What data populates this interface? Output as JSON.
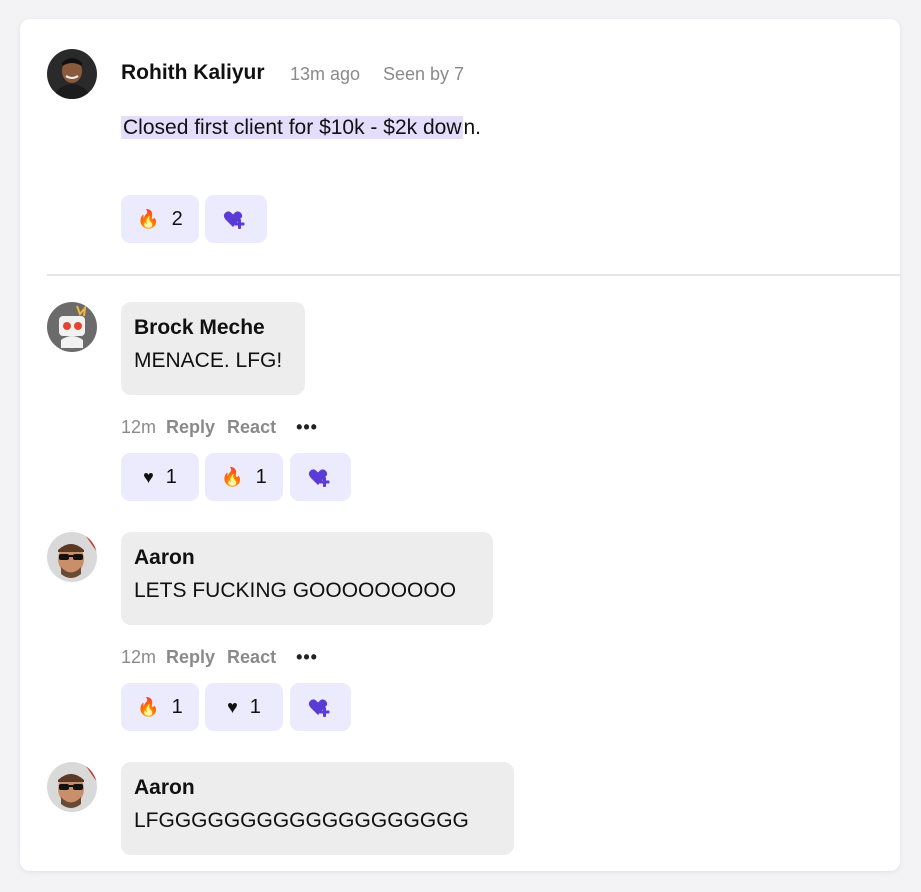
{
  "post": {
    "author": "Rohith Kaliyur",
    "time": "13m ago",
    "seen": "Seen by 7",
    "text_highlighted": "Closed first client for $10k - $2k dow",
    "text_rest": "n.",
    "reactions": [
      {
        "icon": "fire-emoji",
        "emoji": "🔥",
        "count": "2"
      }
    ]
  },
  "comments": [
    {
      "name": "Brock Meche",
      "message": "MENACE. LFG!",
      "time": "12m",
      "reply": "Reply",
      "react": "React",
      "more": "•••",
      "reactions": [
        {
          "icon": "heart-emoji",
          "emoji": "♥",
          "count": "1"
        },
        {
          "icon": "fire-emoji",
          "emoji": "🔥",
          "count": "1"
        }
      ]
    },
    {
      "name": "Aaron",
      "message": "LETS FUCKING GOOOOOOOOO",
      "time": "12m",
      "reply": "Reply",
      "react": "React",
      "more": "•••",
      "reactions": [
        {
          "icon": "fire-emoji",
          "emoji": "🔥",
          "count": "1"
        },
        {
          "icon": "heart-emoji",
          "emoji": "♥",
          "count": "1"
        }
      ]
    },
    {
      "name": "Aaron",
      "message": "LFGGGGGGGGGGGGGGGGGGG"
    }
  ],
  "colors": {
    "accent": "#5b3bd6",
    "pill_bg": "#eceafd",
    "highlight": "#e4ddfb",
    "bubble_bg": "#ededed"
  }
}
